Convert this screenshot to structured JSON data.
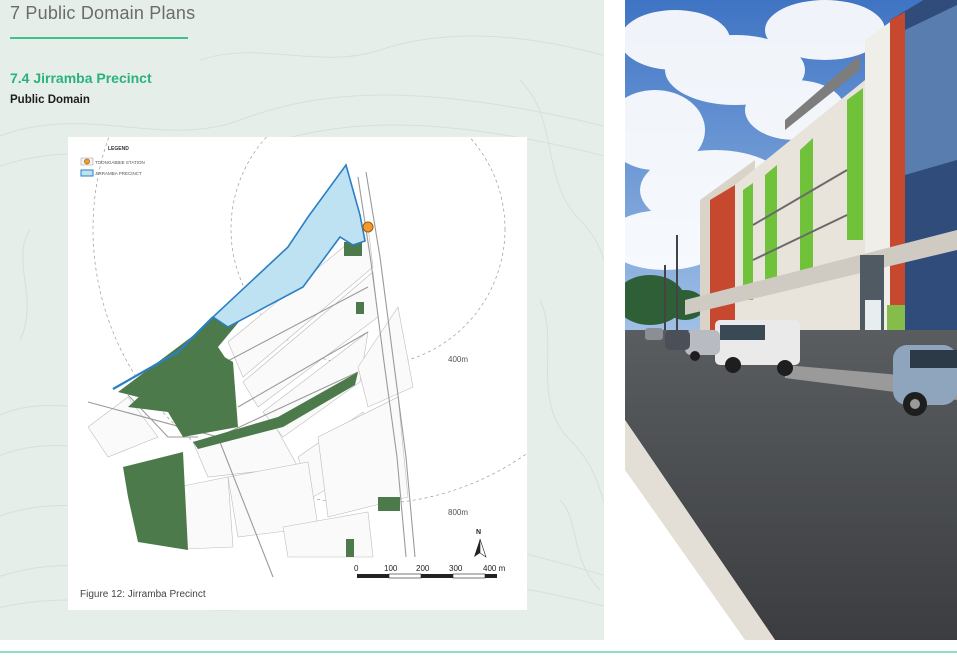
{
  "header": {
    "section_title": "7 Public Domain Plans",
    "subsection_title": "7.4 Jirramba Precinct",
    "subsection_subtitle": "Public Domain"
  },
  "map": {
    "legend": {
      "heading": "LEGEND",
      "items": [
        {
          "label": "TOONGABBIE STATION",
          "icon": "station-marker-icon"
        },
        {
          "label": "JIRRAMBA PRECINCT",
          "icon": "precinct-swatch-icon"
        }
      ]
    },
    "radius_labels": [
      "400m",
      "800m"
    ],
    "north_label": "N",
    "scale_ticks": [
      "0",
      "100",
      "200",
      "300",
      "400 m"
    ],
    "caption": "Figure 12: Jirramba Precinct"
  },
  "photo": {
    "icon": "street-photo-icon"
  },
  "colors": {
    "accent": "#3ec28c",
    "title_green": "#2ab27b",
    "open_space": "#4c7a4b",
    "precinct_fill": "#bfe2f2",
    "precinct_outline": "#2b7fc4",
    "station": "#f29a2e"
  }
}
